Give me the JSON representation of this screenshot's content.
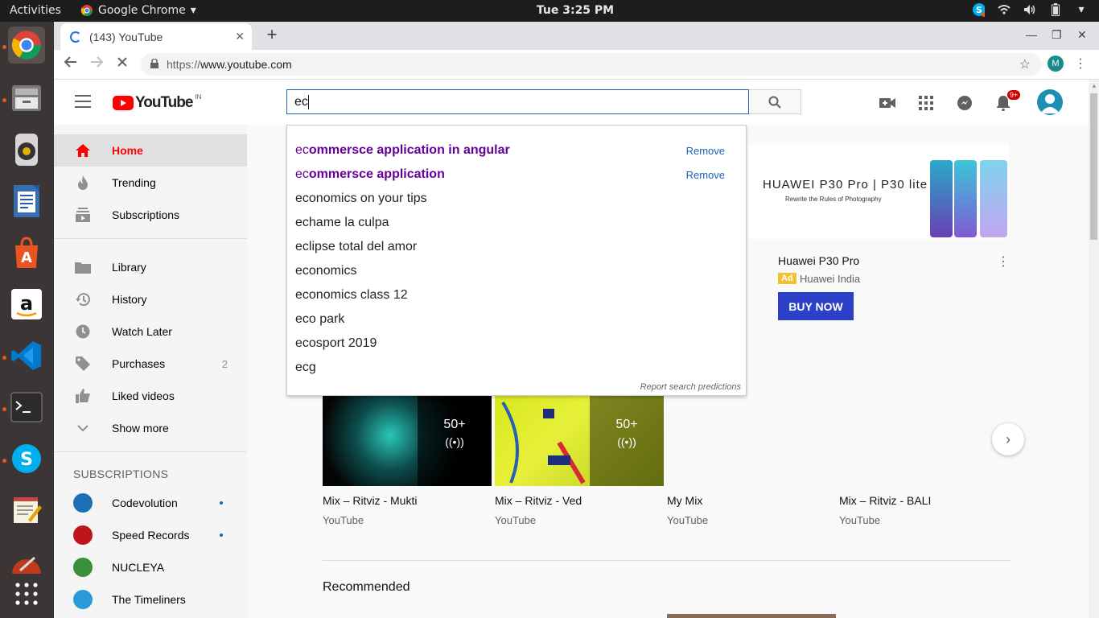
{
  "system": {
    "activities": "Activities",
    "app_menu": "Google Chrome",
    "clock": "Tue  3:25 PM"
  },
  "browser": {
    "tab_title": "(143) YouTube",
    "url_prefix": "https://",
    "url_host": "www.youtube.com",
    "profile_initial": "M"
  },
  "youtube": {
    "logo_text": "YouTube",
    "country_code": "IN",
    "search_value": "ec",
    "notification_count": "9+",
    "sidebar": {
      "items": [
        {
          "label": "Home"
        },
        {
          "label": "Trending"
        },
        {
          "label": "Subscriptions"
        },
        {
          "label": "Library"
        },
        {
          "label": "History"
        },
        {
          "label": "Watch Later"
        },
        {
          "label": "Purchases",
          "count": "2"
        },
        {
          "label": "Liked videos"
        },
        {
          "label": "Show more"
        }
      ],
      "subscriptions_heading": "SUBSCRIPTIONS",
      "channels": [
        {
          "label": "Codevolution"
        },
        {
          "label": "Speed Records"
        },
        {
          "label": "NUCLEYA"
        },
        {
          "label": "The Timeliners"
        }
      ]
    },
    "suggestions": {
      "typed": "ec",
      "items": [
        {
          "rest": "ommersce application in angular",
          "history": true
        },
        {
          "rest": "ommersce application",
          "history": true
        },
        {
          "rest": "onomics on your tips",
          "history": false
        },
        {
          "rest": "hame la culpa",
          "history": false
        },
        {
          "rest": "lipse total del amor",
          "history": false
        },
        {
          "rest": "onomics",
          "history": false
        },
        {
          "rest": "onomics class 12",
          "history": false
        },
        {
          "rest": "o park",
          "history": false
        },
        {
          "rest": "osport 2019",
          "history": false
        },
        {
          "rest": "g",
          "history": false
        }
      ],
      "remove_label": "Remove",
      "report_label": "Report search predictions"
    },
    "ad": {
      "brand": "HUAWEI P30 Pro | P30 lite",
      "tagline": "Rewrite the Rules of Photography",
      "title": "Huawei P30 Pro",
      "tag": "Ad",
      "advertiser": "Huawei India",
      "cta": "BUY NOW"
    },
    "cards": [
      {
        "title": "Mix – Ritviz - Mukti",
        "channel": "YouTube",
        "count": "50+"
      },
      {
        "title": "Mix – Ritviz - Ved",
        "channel": "YouTube",
        "count": "50+"
      },
      {
        "title": "My Mix",
        "channel": "YouTube"
      },
      {
        "title": "Mix – Ritviz - BALI",
        "channel": "YouTube"
      }
    ],
    "recommended_heading": "Recommended"
  },
  "colors": {
    "brand_red": "#ff0000",
    "link_blue": "#1c62b9",
    "history_purple": "#660099",
    "cta_blue": "#2b3fc7"
  }
}
